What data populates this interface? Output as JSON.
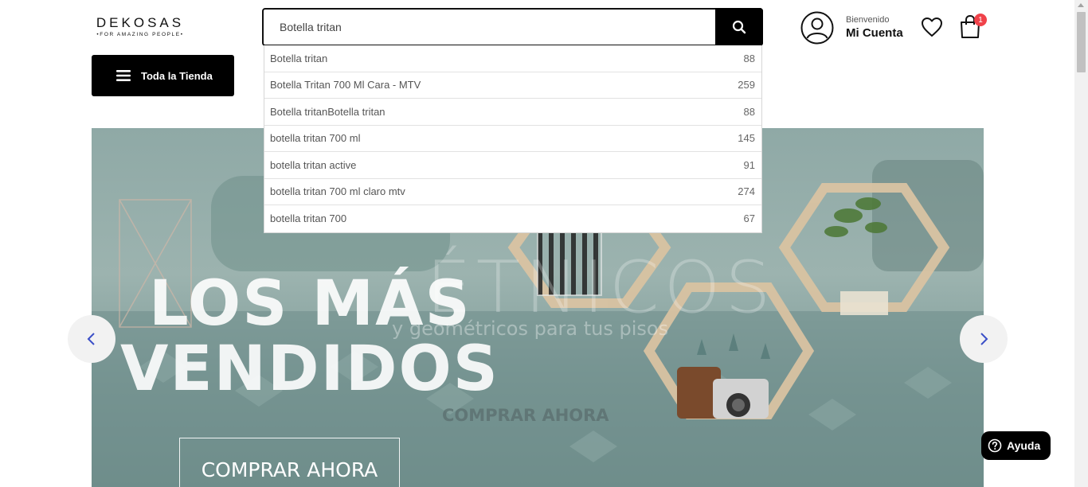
{
  "header": {
    "logo_main": "DEKOSAS",
    "logo_tagline": "•FOR AMAZING PEOPLE•",
    "search": {
      "value": "Botella tritan",
      "placeholder": ""
    },
    "account": {
      "greeting": "Bienvenido",
      "label": "Mi Cuenta"
    },
    "cart_count": "1"
  },
  "nav": {
    "menu_label": "Toda la Tienda"
  },
  "suggestions": [
    {
      "label": "Botella tritan",
      "count": "88"
    },
    {
      "label": "Botella Tritan 700 Ml Cara - MTV",
      "count": "259"
    },
    {
      "label": "Botella tritanBotella tritan",
      "count": "88"
    },
    {
      "label": "botella tritan 700 ml",
      "count": "145"
    },
    {
      "label": "botella tritan active",
      "count": "91"
    },
    {
      "label": "botella tritan 700 ml claro mtv",
      "count": "274"
    },
    {
      "label": "botella tritan 700",
      "count": "67"
    }
  ],
  "banner": {
    "title_line1": "LOS MÁS",
    "title_line2": "VENDIDOS",
    "cta": "COMPRAR AHORA",
    "ghost_title": "ÉTNICOS",
    "ghost_subtitle": "y geométricos para tus pisos",
    "ghost_cta": "COMPRAR AHORA"
  },
  "help": {
    "label": "Ayuda"
  },
  "colors": {
    "accent": "#000000",
    "badge": "#f0424a",
    "arrow": "#3b4fc7"
  },
  "icons": [
    "search-icon",
    "user-icon",
    "heart-icon",
    "cart-icon",
    "menu-icon",
    "chevron-left-icon",
    "chevron-right-icon",
    "help-icon"
  ]
}
